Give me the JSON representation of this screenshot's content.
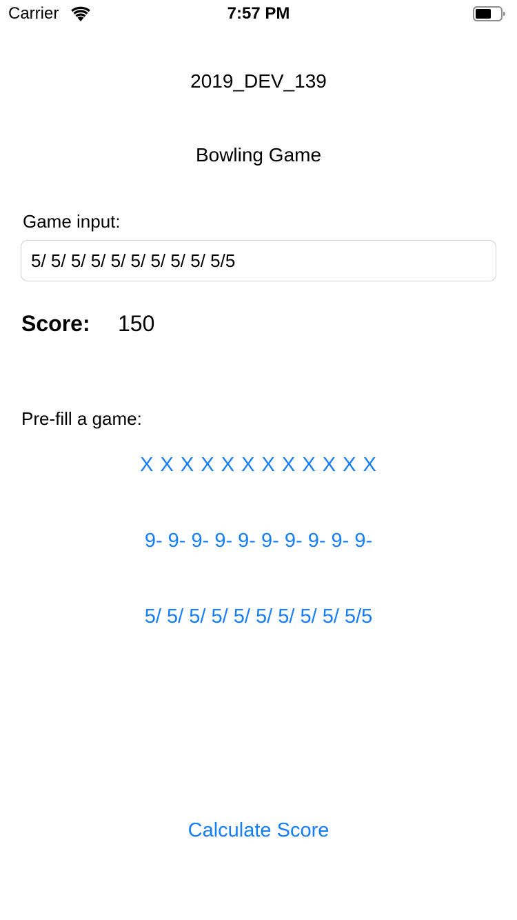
{
  "status_bar": {
    "carrier": "Carrier",
    "time": "7:57 PM",
    "wifi_icon": "wifi-icon",
    "battery_icon": "battery-icon"
  },
  "header": {
    "title": "2019_DEV_139",
    "subtitle": "Bowling Game"
  },
  "game_input": {
    "label": "Game input:",
    "value": "5/ 5/ 5/ 5/ 5/ 5/ 5/ 5/ 5/ 5/5"
  },
  "score": {
    "label": "Score:",
    "value": "150"
  },
  "prefill": {
    "label": "Pre-fill a game:",
    "options": [
      "X X X X X X X X X X X X",
      "9- 9- 9- 9- 9- 9- 9- 9- 9- 9-",
      "5/ 5/ 5/ 5/ 5/ 5/ 5/ 5/ 5/ 5/5"
    ]
  },
  "actions": {
    "calculate_label": "Calculate Score"
  },
  "colors": {
    "accent": "#147efb",
    "text": "#000000",
    "input_border": "#cfcfd4",
    "background": "#ffffff"
  }
}
